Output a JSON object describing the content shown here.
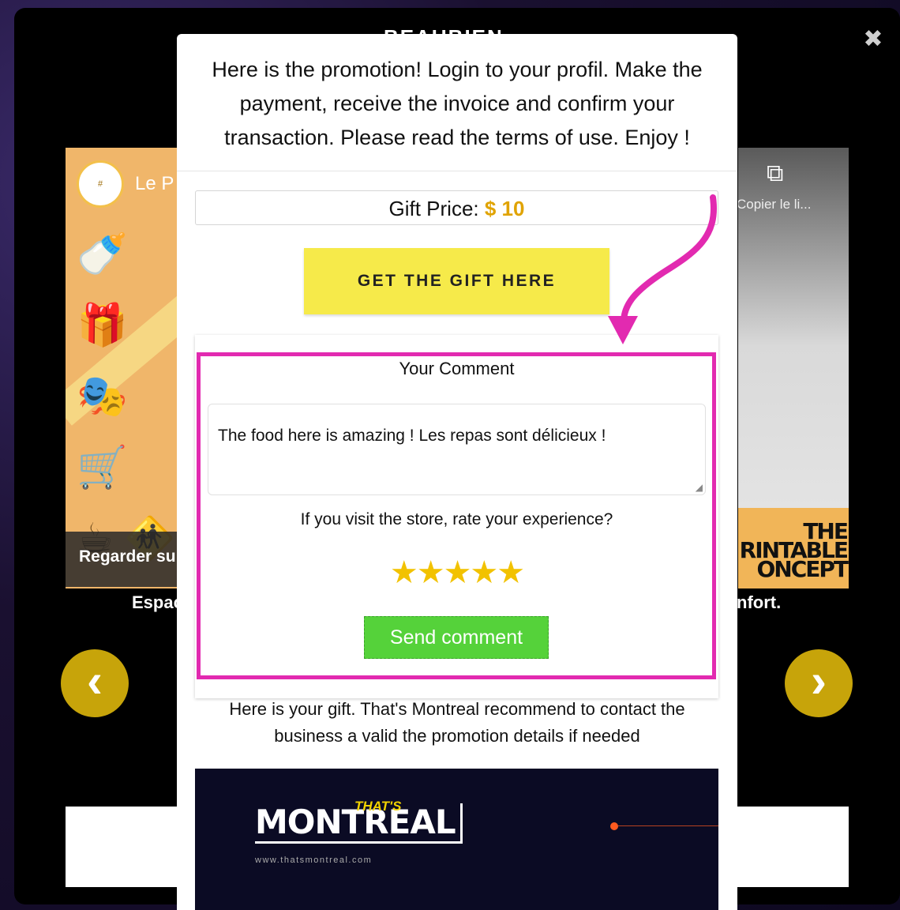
{
  "background": {
    "slide_title": "BEAUBIEN",
    "left_card": {
      "logo_text": "Le P",
      "watch_label": "Regarder su",
      "caption": "Espac"
    },
    "right_card": {
      "copy_label": "Copier le li...",
      "poster_text": "THE\nRINTABLE\nONCEPT",
      "caption": "nfort."
    },
    "nav_prev_glyph": "‹",
    "nav_next_glyph": "›",
    "close_glyph": "✖"
  },
  "modal": {
    "promo_lines": [
      "Here is the promotion! Login to your profil. Make the",
      "payment, receive the invoice and confirm your",
      "transaction. Please read the terms of use. Enjoy !"
    ],
    "gift_price_label": "Gift Price:",
    "gift_price_value": "$ 10",
    "get_gift_button": "GET THE GIFT HERE",
    "comment": {
      "label": "Your Comment",
      "value": "The food here is amazing ! Les repas sont délicieux !",
      "rate_question": "If you visit the store, rate your experience?",
      "stars": "★★★★★",
      "rating": 5,
      "send_button": "Send comment"
    },
    "gift_note_lines": [
      "Here is your gift. That's Montreal recommend to contact the",
      "business a valid the promotion details if needed"
    ],
    "banner": {
      "logo_main": "MONTREAL",
      "logo_small": "THAT'S",
      "url": "www.thatsmontreal.com"
    }
  },
  "colors": {
    "highlight": "#e22ab0",
    "gift_button": "#f6ea4a",
    "send_button": "#55d23a",
    "price": "#e0a300",
    "nav": "#c7a40a"
  }
}
